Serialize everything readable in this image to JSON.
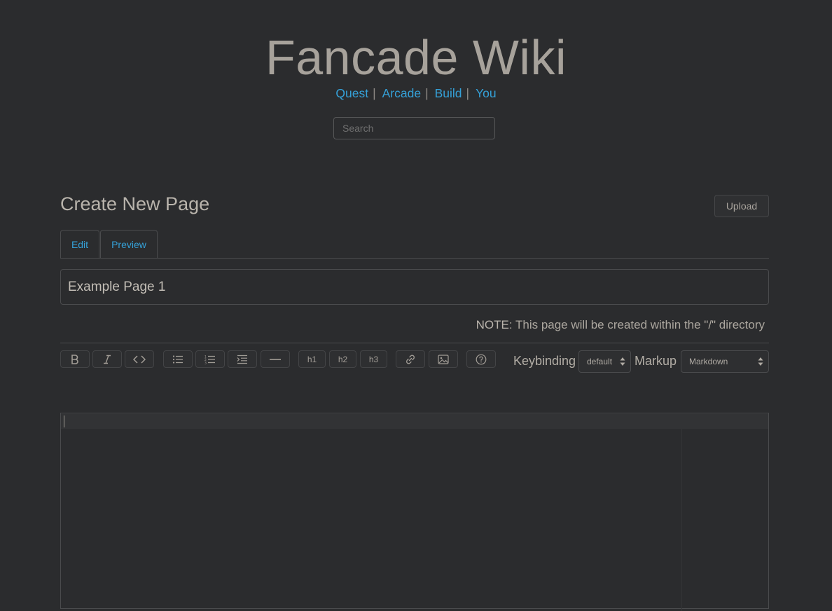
{
  "site": {
    "title": "Fancade Wiki",
    "nav": [
      {
        "label": "Quest"
      },
      {
        "label": "Arcade"
      },
      {
        "label": "Build"
      },
      {
        "label": "You"
      }
    ],
    "nav_separator": "|",
    "search_placeholder": "Search"
  },
  "page": {
    "heading": "Create New Page",
    "upload_label": "Upload",
    "tabs": [
      {
        "label": "Edit",
        "active": true
      },
      {
        "label": "Preview",
        "active": false
      }
    ],
    "title_value": "Example Page 1",
    "note_strong": "NOTE",
    "note_text": ": This page will be created within the \"/\" directory"
  },
  "toolbar": {
    "buttons": [
      {
        "name": "bold-button",
        "icon": "bold-icon"
      },
      {
        "name": "italic-button",
        "icon": "italic-icon"
      },
      {
        "name": "code-button",
        "icon": "code-icon"
      },
      {
        "name": "bulleted-list-button",
        "icon": "list-ul-icon"
      },
      {
        "name": "numbered-list-button",
        "icon": "list-ol-icon"
      },
      {
        "name": "indent-button",
        "icon": "indent-icon"
      },
      {
        "name": "horizontal-rule-button",
        "icon": "minus-icon"
      },
      {
        "name": "heading1-button",
        "label": "h1"
      },
      {
        "name": "heading2-button",
        "label": "h2"
      },
      {
        "name": "heading3-button",
        "label": "h3"
      },
      {
        "name": "link-button",
        "icon": "link-icon"
      },
      {
        "name": "image-button",
        "icon": "image-icon"
      },
      {
        "name": "help-button",
        "icon": "question-circle-icon"
      }
    ],
    "keybinding_label": "Keybinding",
    "keybinding_value": "default",
    "markup_label": "Markup",
    "markup_value": "Markdown"
  },
  "editor": {
    "content": ""
  },
  "colors": {
    "background": "#2b2c2e",
    "link": "#35a1d8",
    "text": "#b9b4ac",
    "border": "#4a4b4d"
  }
}
